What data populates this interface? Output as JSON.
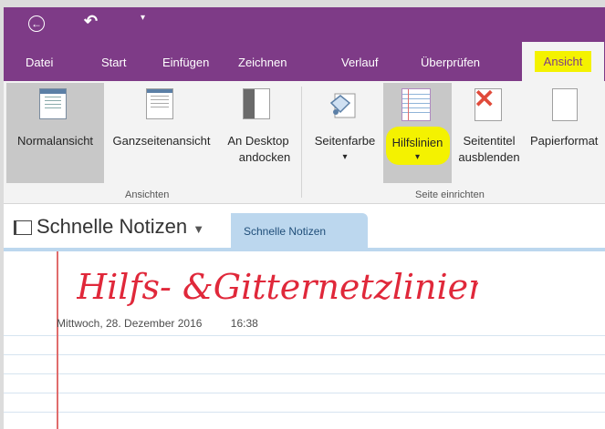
{
  "quick_access": {
    "back_icon": "back-arrow-circle-icon",
    "undo_icon": "undo-icon",
    "customize_icon": "customize-caret-icon"
  },
  "tabs": [
    {
      "label": "Datei"
    },
    {
      "label": "Start"
    },
    {
      "label": "Einfügen"
    },
    {
      "label": "Zeichnen"
    },
    {
      "label": "Verlauf"
    },
    {
      "label": "Überprüfen"
    },
    {
      "label": "Ansicht",
      "active": true
    }
  ],
  "ribbon": {
    "groups": {
      "views": "Ansichten",
      "page_setup": "Seite einrichten"
    },
    "buttons": {
      "normal_view": "Normalansicht",
      "full_page_view": "Ganzseitenansicht",
      "dock_line1": "An Desktop",
      "dock_line2": "andocken",
      "page_color": "Seitenfarbe",
      "rule_lines": "Hilfslinien",
      "hide_title_line1": "Seitentitel",
      "hide_title_line2": "ausblenden",
      "paper_size": "Papierformat"
    },
    "highlight_color": "#f4f200"
  },
  "notebook": {
    "title": "Schnelle Notizen",
    "section_tab": "Schnelle Notizen"
  },
  "page": {
    "handwritten_title": "Hilfs- &Gitternetzlinien",
    "date": "Mittwoch, 28. Dezember 2016",
    "time": "16:38"
  },
  "colors": {
    "brand": "#7e3b87",
    "section_tab": "#bcd7ee",
    "margin_line": "#e06c6c",
    "ink": "#e0283a"
  }
}
